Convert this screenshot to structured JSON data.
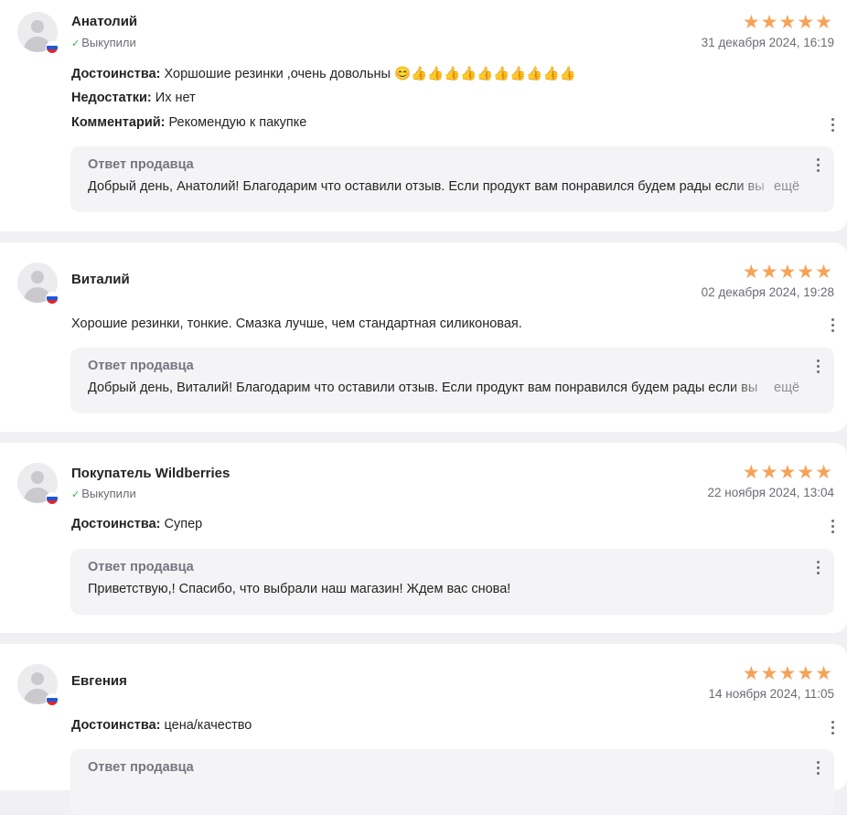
{
  "reviews": [
    {
      "name": "Анатолий",
      "bought": "Выкупили",
      "stars": "★★★★★",
      "date": "31 декабря 2024, 16:19",
      "pros_label": "Достоинства:",
      "pros": "Хоршошие резинки ,очень довольны 😊👍👍👍👍👍👍👍👍👍👍",
      "cons_label": "Недостатки:",
      "cons": "Их нет",
      "comment_label": "Комментарий:",
      "comment": "Рекомендую к пакупке",
      "reply_title": "Ответ продавца",
      "reply_text": "Добрый день, Анатолий! Благодарим что оставили отзыв. Если продукт вам понравился будем рады если вы",
      "reply_more": "ещё"
    },
    {
      "name": "Виталий",
      "stars": "★★★★★",
      "date": "02 декабря 2024, 19:28",
      "text": "Хорошие резинки, тонкие. Смазка лучше, чем стандартная силиконовая.",
      "reply_title": "Ответ продавца",
      "reply_text": "Добрый день, Виталий! Благодарим что оставили отзыв. Если продукт вам понравился будем рады если вы",
      "reply_more": "ещё"
    },
    {
      "name": "Покупатель Wildberries",
      "bought": "Выкупили",
      "stars": "★★★★★",
      "date": "22 ноября 2024, 13:04",
      "pros_label": "Достоинства:",
      "pros": "Супер",
      "reply_title": "Ответ продавца",
      "reply_text": "Приветствую,! Спасибо, что выбрали наш магазин! Ждем вас снова!"
    },
    {
      "name": "Евгения",
      "stars": "★★★★★",
      "date": "14 ноября 2024, 11:05",
      "pros_label": "Достоинства:",
      "pros": "цена/качество",
      "reply_title": "Ответ продавца"
    }
  ],
  "colors": {
    "star": "#f5a359",
    "check": "#2fb44a",
    "page_bg": "#f1f1f4",
    "card_bg": "#ffffff",
    "reply_bg": "#f4f4f6",
    "flag": [
      "#ffffff",
      "#1c57d6",
      "#e0252f"
    ]
  },
  "icons": [
    "user-avatar-icon",
    "russia-flag-icon",
    "check-icon",
    "star-icon",
    "more-vertical-icon"
  ]
}
